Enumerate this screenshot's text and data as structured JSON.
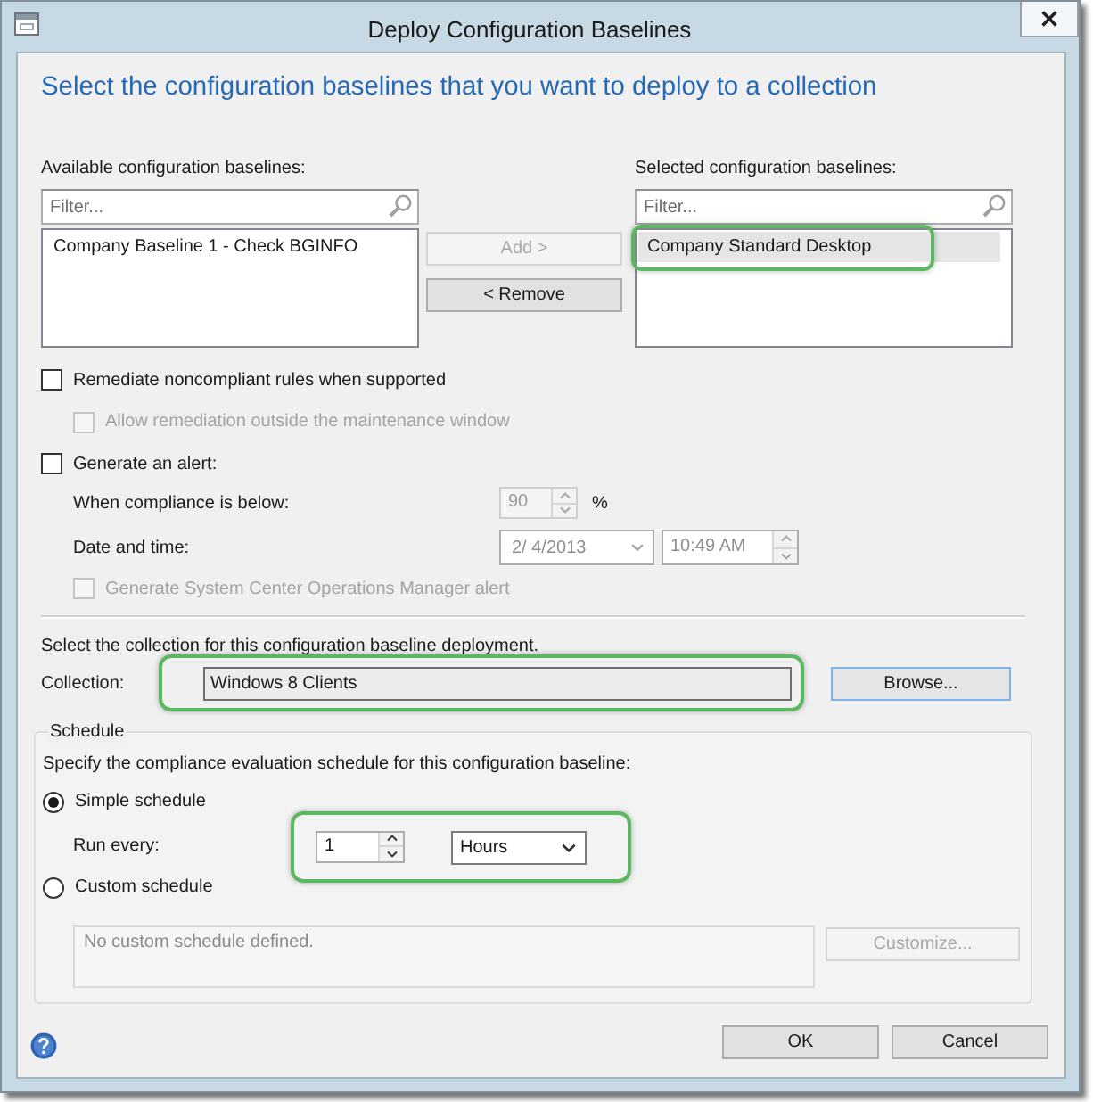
{
  "window": {
    "title": "Deploy Configuration Baselines"
  },
  "heading": "Select the configuration baselines that you want to deploy to a collection",
  "available_list": {
    "label": "Available configuration baselines:",
    "filter": {
      "placeholder": "Filter..."
    },
    "items": [
      {
        "text": "Company Baseline 1 - Check BGINFO",
        "selected": false,
        "highlighted": false
      }
    ]
  },
  "transfer_buttons": [
    {
      "label": "Add >",
      "disabled": true
    },
    {
      "label": "< Remove",
      "disabled": false
    }
  ],
  "selected_list": {
    "label": "Selected configuration baselines:",
    "filter": {
      "placeholder": "Filter..."
    },
    "items": [
      {
        "text": "Company Standard Desktop",
        "selected": true,
        "highlighted": true
      }
    ]
  },
  "remediate": {
    "label": "Remediate noncompliant rules when supported",
    "checked": false,
    "disabled": false,
    "children": [
      {
        "label": "Allow remediation outside the maintenance window",
        "checked": false,
        "disabled": true
      }
    ]
  },
  "alert": {
    "label": "Generate an alert:",
    "checked": false,
    "disabled": false,
    "compliance": {
      "label": "When compliance is below:",
      "value": "90",
      "unit": "%",
      "disabled": true
    },
    "date_time": {
      "label": "Date and time:",
      "date": "2/ 4/2013",
      "time": "10:49 AM",
      "disabled": true
    },
    "children": [
      {
        "label": "Generate System Center Operations Manager alert",
        "checked": false,
        "disabled": true
      }
    ]
  },
  "collection": {
    "prompt": "Select the collection for this configuration baseline deployment.",
    "label": "Collection:",
    "value": "Windows 8 Clients",
    "highlighted": true,
    "browse": {
      "label": "Browse..."
    }
  },
  "schedule": {
    "title": "Schedule",
    "prompt": "Specify the compliance evaluation schedule for this configuration baseline:",
    "options": [
      {
        "kind": "simple",
        "label": "Simple schedule",
        "selected": true
      },
      {
        "kind": "custom",
        "label": "Custom schedule",
        "selected": false
      }
    ],
    "run_every": {
      "label": "Run every:",
      "value": "1",
      "unit": "Hours",
      "highlighted": true
    },
    "custom": {
      "value": "No custom schedule defined.",
      "disabled": true,
      "button": {
        "label": "Customize...",
        "disabled": true
      }
    }
  },
  "footer": {
    "buttons": [
      {
        "label": "OK"
      },
      {
        "label": "Cancel"
      }
    ]
  }
}
